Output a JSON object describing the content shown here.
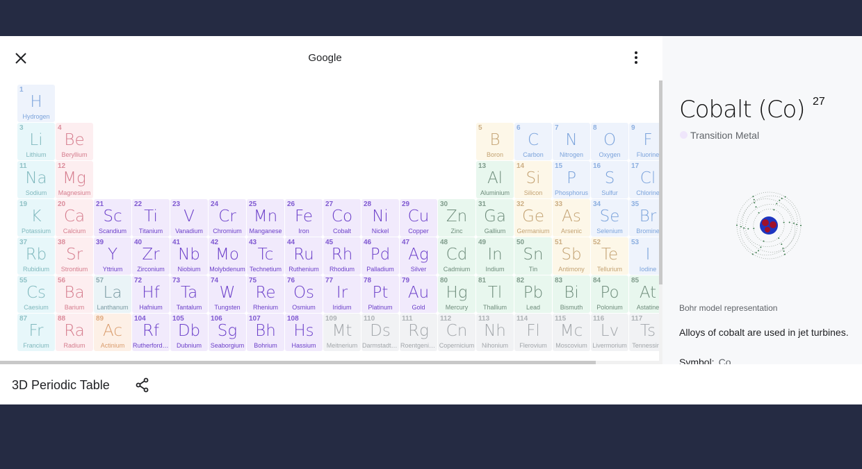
{
  "header": {
    "title": "Google",
    "close_icon": "close-icon",
    "menu_icon": "more-vert-icon"
  },
  "footer": {
    "title": "3D Periodic Table",
    "share_icon": "share-icon"
  },
  "detail": {
    "title": "Cobalt (Co)",
    "atomic_number": "27",
    "category": "Transition Metal",
    "category_color": "#efe6fb",
    "bohr_caption": "Bohr model representation",
    "fact": "Alloys of cobalt are used in jet turbines.",
    "symbol_label": "Symbol:",
    "symbol_value": "Co"
  },
  "categories": {
    "nonmetal": {
      "bg": "#eef3fc",
      "fg": "#7ba3db"
    },
    "alkali": {
      "bg": "#e7f7fa",
      "fg": "#7fb8bd"
    },
    "alkaline": {
      "bg": "#fdeef0",
      "fg": "#d57c8d"
    },
    "transition": {
      "bg": "#f1eafc",
      "fg": "#6b3fc9"
    },
    "lanthanide": {
      "bg": "#eaf4f7",
      "fg": "#7a9aa2"
    },
    "actinide": {
      "bg": "#fdf0e6",
      "fg": "#d99c6c"
    },
    "post": {
      "bg": "#e8f7ee",
      "fg": "#6e8c7b"
    },
    "metalloid": {
      "bg": "#fdf7e8",
      "fg": "#c3a272"
    },
    "unknown": {
      "bg": "#f1f2f4",
      "fg": "#a2a6aa"
    }
  },
  "elements": [
    [
      1,
      "H",
      "Hydrogen",
      1,
      1,
      "nonmetal"
    ],
    [
      3,
      "Li",
      "Lithium",
      1,
      2,
      "alkali"
    ],
    [
      4,
      "Be",
      "Beryllium",
      2,
      2,
      "alkaline"
    ],
    [
      5,
      "B",
      "Boron",
      13,
      2,
      "metalloid"
    ],
    [
      6,
      "C",
      "Carbon",
      14,
      2,
      "nonmetal"
    ],
    [
      7,
      "N",
      "Nitrogen",
      15,
      2,
      "nonmetal"
    ],
    [
      8,
      "O",
      "Oxygen",
      16,
      2,
      "nonmetal"
    ],
    [
      9,
      "F",
      "Fluorine",
      17,
      2,
      "nonmetal"
    ],
    [
      11,
      "Na",
      "Sodium",
      1,
      3,
      "alkali"
    ],
    [
      12,
      "Mg",
      "Magnesium",
      2,
      3,
      "alkaline"
    ],
    [
      13,
      "Al",
      "Aluminium",
      13,
      3,
      "post"
    ],
    [
      14,
      "Si",
      "Silicon",
      14,
      3,
      "metalloid"
    ],
    [
      15,
      "P",
      "Phosphorus",
      15,
      3,
      "nonmetal"
    ],
    [
      16,
      "S",
      "Sulfur",
      16,
      3,
      "nonmetal"
    ],
    [
      17,
      "Cl",
      "Chlorine",
      17,
      3,
      "nonmetal"
    ],
    [
      19,
      "K",
      "Potassium",
      1,
      4,
      "alkali"
    ],
    [
      20,
      "Ca",
      "Calcium",
      2,
      4,
      "alkaline"
    ],
    [
      21,
      "Sc",
      "Scandium",
      3,
      4,
      "transition"
    ],
    [
      22,
      "Ti",
      "Titanium",
      4,
      4,
      "transition"
    ],
    [
      23,
      "V",
      "Vanadium",
      5,
      4,
      "transition"
    ],
    [
      24,
      "Cr",
      "Chromium",
      6,
      4,
      "transition"
    ],
    [
      25,
      "Mn",
      "Manganese",
      7,
      4,
      "transition"
    ],
    [
      26,
      "Fe",
      "Iron",
      8,
      4,
      "transition"
    ],
    [
      27,
      "Co",
      "Cobalt",
      9,
      4,
      "transition"
    ],
    [
      28,
      "Ni",
      "Nickel",
      10,
      4,
      "transition"
    ],
    [
      29,
      "Cu",
      "Copper",
      11,
      4,
      "transition"
    ],
    [
      30,
      "Zn",
      "Zinc",
      12,
      4,
      "post"
    ],
    [
      31,
      "Ga",
      "Gallium",
      13,
      4,
      "post"
    ],
    [
      32,
      "Ge",
      "Germanium",
      14,
      4,
      "metalloid"
    ],
    [
      33,
      "As",
      "Arsenic",
      15,
      4,
      "metalloid"
    ],
    [
      34,
      "Se",
      "Selenium",
      16,
      4,
      "nonmetal"
    ],
    [
      35,
      "Br",
      "Bromine",
      17,
      4,
      "nonmetal"
    ],
    [
      37,
      "Rb",
      "Rubidium",
      1,
      5,
      "alkali"
    ],
    [
      38,
      "Sr",
      "Strontium",
      2,
      5,
      "alkaline"
    ],
    [
      39,
      "Y",
      "Yttrium",
      3,
      5,
      "transition"
    ],
    [
      40,
      "Zr",
      "Zirconium",
      4,
      5,
      "transition"
    ],
    [
      41,
      "Nb",
      "Niobium",
      5,
      5,
      "transition"
    ],
    [
      42,
      "Mo",
      "Molybdenum",
      6,
      5,
      "transition"
    ],
    [
      43,
      "Tc",
      "Technetium",
      7,
      5,
      "transition"
    ],
    [
      44,
      "Ru",
      "Ruthenium",
      8,
      5,
      "transition"
    ],
    [
      45,
      "Rh",
      "Rhodium",
      9,
      5,
      "transition"
    ],
    [
      46,
      "Pd",
      "Palladium",
      10,
      5,
      "transition"
    ],
    [
      47,
      "Ag",
      "Silver",
      11,
      5,
      "transition"
    ],
    [
      48,
      "Cd",
      "Cadmium",
      12,
      5,
      "post"
    ],
    [
      49,
      "In",
      "Indium",
      13,
      5,
      "post"
    ],
    [
      50,
      "Sn",
      "Tin",
      14,
      5,
      "post"
    ],
    [
      51,
      "Sb",
      "Antimony",
      15,
      5,
      "metalloid"
    ],
    [
      52,
      "Te",
      "Tellurium",
      16,
      5,
      "metalloid"
    ],
    [
      53,
      "I",
      "Iodine",
      17,
      5,
      "nonmetal"
    ],
    [
      55,
      "Cs",
      "Caesium",
      1,
      6,
      "alkali"
    ],
    [
      56,
      "Ba",
      "Barium",
      2,
      6,
      "alkaline"
    ],
    [
      57,
      "La",
      "Lanthanum",
      3,
      6,
      "lanthanide"
    ],
    [
      72,
      "Hf",
      "Hafnium",
      4,
      6,
      "transition"
    ],
    [
      73,
      "Ta",
      "Tantalum",
      5,
      6,
      "transition"
    ],
    [
      74,
      "W",
      "Tungsten",
      6,
      6,
      "transition"
    ],
    [
      75,
      "Re",
      "Rhenium",
      7,
      6,
      "transition"
    ],
    [
      76,
      "Os",
      "Osmium",
      8,
      6,
      "transition"
    ],
    [
      77,
      "Ir",
      "Iridium",
      9,
      6,
      "transition"
    ],
    [
      78,
      "Pt",
      "Platinum",
      10,
      6,
      "transition"
    ],
    [
      79,
      "Au",
      "Gold",
      11,
      6,
      "transition"
    ],
    [
      80,
      "Hg",
      "Mercury",
      12,
      6,
      "post"
    ],
    [
      81,
      "Tl",
      "Thallium",
      13,
      6,
      "post"
    ],
    [
      82,
      "Pb",
      "Lead",
      14,
      6,
      "post"
    ],
    [
      83,
      "Bi",
      "Bismuth",
      15,
      6,
      "post"
    ],
    [
      84,
      "Po",
      "Polonium",
      16,
      6,
      "post"
    ],
    [
      85,
      "At",
      "Astatine",
      17,
      6,
      "post"
    ],
    [
      87,
      "Fr",
      "Francium",
      1,
      7,
      "alkali"
    ],
    [
      88,
      "Ra",
      "Radium",
      2,
      7,
      "alkaline"
    ],
    [
      89,
      "Ac",
      "Actinium",
      3,
      7,
      "actinide"
    ],
    [
      104,
      "Rf",
      "Rutherfordium",
      4,
      7,
      "transition"
    ],
    [
      105,
      "Db",
      "Dubnium",
      5,
      7,
      "transition"
    ],
    [
      106,
      "Sg",
      "Seaborgium",
      6,
      7,
      "transition"
    ],
    [
      107,
      "Bh",
      "Bohrium",
      7,
      7,
      "transition"
    ],
    [
      108,
      "Hs",
      "Hassium",
      8,
      7,
      "transition"
    ],
    [
      109,
      "Mt",
      "Meitnerium",
      9,
      7,
      "unknown"
    ],
    [
      110,
      "Ds",
      "Darmstadtium",
      10,
      7,
      "unknown"
    ],
    [
      111,
      "Rg",
      "Roentgenium",
      11,
      7,
      "unknown"
    ],
    [
      112,
      "Cn",
      "Copernicium",
      12,
      7,
      "unknown"
    ],
    [
      113,
      "Nh",
      "Nihonium",
      13,
      7,
      "unknown"
    ],
    [
      114,
      "Fl",
      "Flerovium",
      14,
      7,
      "unknown"
    ],
    [
      115,
      "Mc",
      "Moscovium",
      15,
      7,
      "unknown"
    ],
    [
      116,
      "Lv",
      "Livermorium",
      16,
      7,
      "unknown"
    ],
    [
      117,
      "Ts",
      "Tennessine",
      17,
      7,
      "unknown"
    ]
  ]
}
